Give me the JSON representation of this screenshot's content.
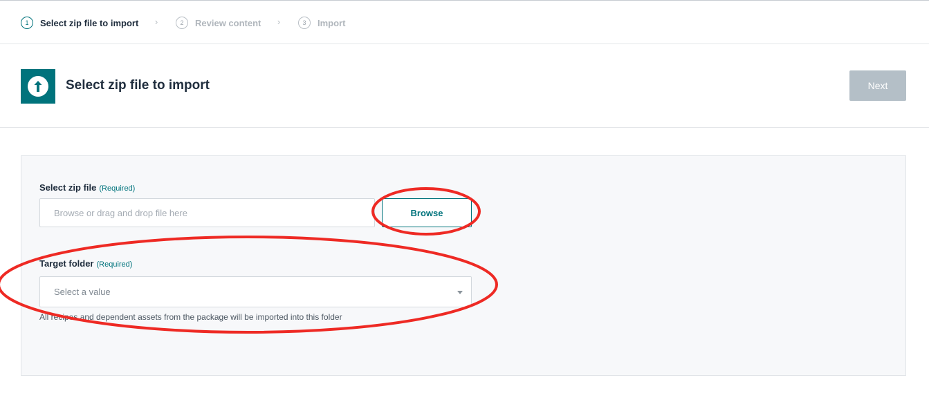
{
  "stepper": {
    "steps": [
      {
        "number": "1",
        "label": "Select zip file to import"
      },
      {
        "number": "2",
        "label": "Review content"
      },
      {
        "number": "3",
        "label": "Import"
      }
    ],
    "separator_icon": "chevron-right-icon"
  },
  "header": {
    "icon": "upload-arrow-icon",
    "title": "Select zip file to import",
    "next_label": "Next"
  },
  "form": {
    "zip_file": {
      "label": "Select zip file",
      "required_text": "(Required)",
      "placeholder": "Browse or drag and drop file here",
      "browse_label": "Browse"
    },
    "target_folder": {
      "label": "Target folder",
      "required_text": "(Required)",
      "placeholder": "Select a value",
      "help_text": "All recipes and dependent assets from the package will be imported into this folder"
    }
  },
  "colors": {
    "accent": "#00737c",
    "disabled_button": "#b4bfc7",
    "annotation": "#ee2a24"
  }
}
